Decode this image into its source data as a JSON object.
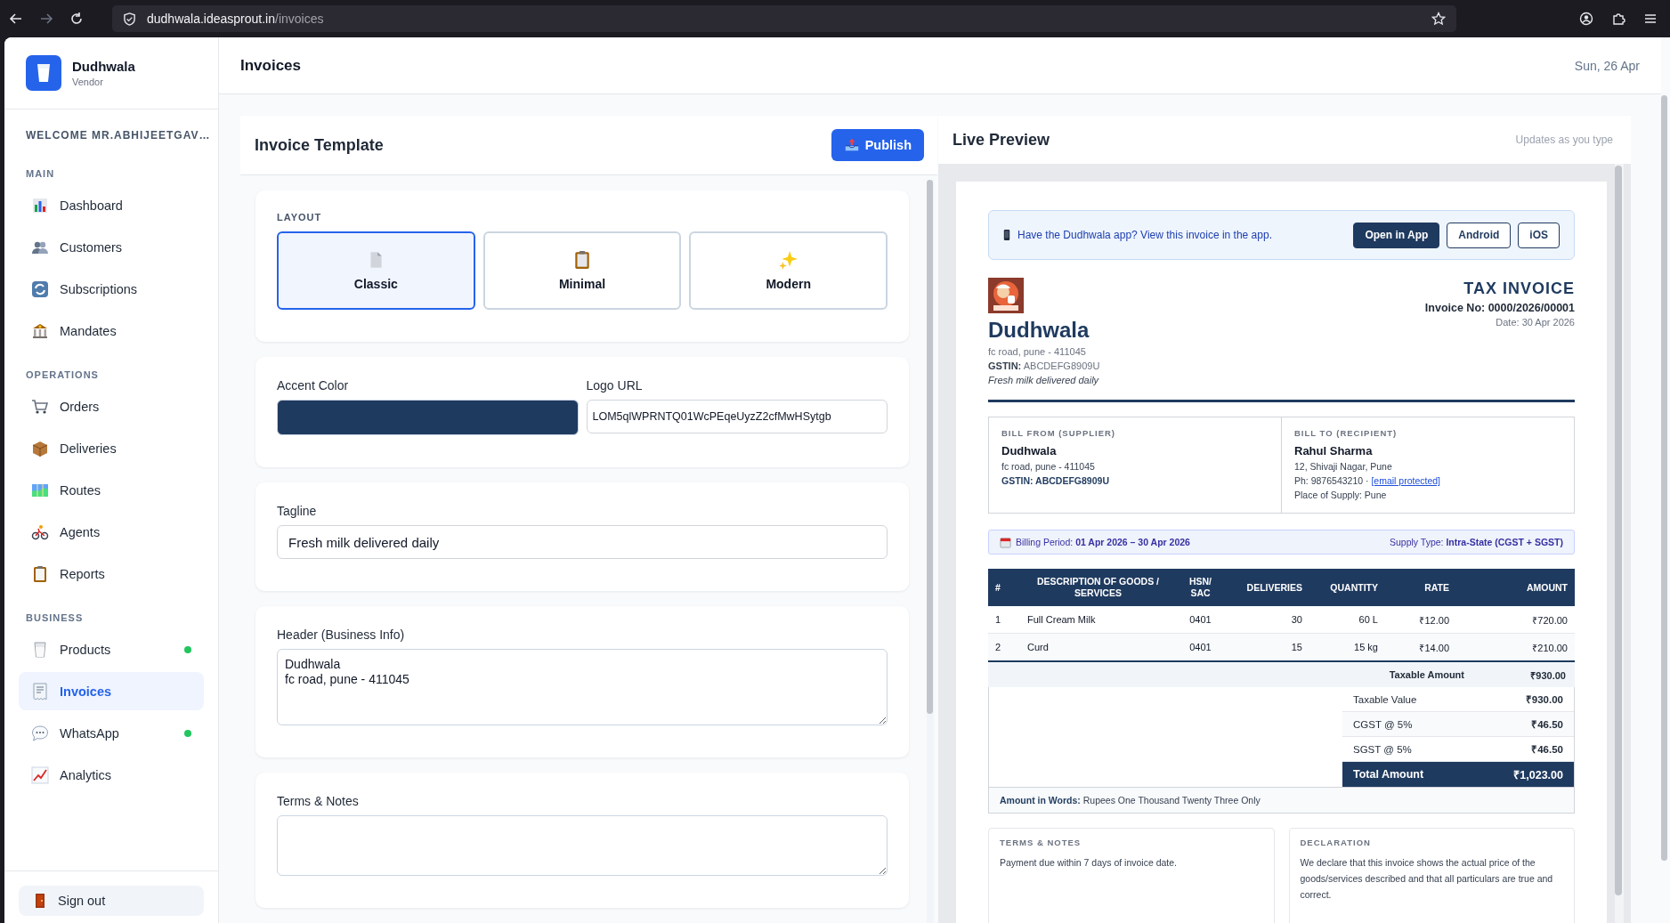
{
  "browser": {
    "url_host": "dudhwala.ideasprout.in",
    "url_path": "/invoices"
  },
  "sidebar": {
    "brand": "Dudhwala",
    "role": "Vendor",
    "welcome": "WELCOME MR.ABHIJEETGAV…",
    "sections": [
      {
        "title": "MAIN",
        "items": [
          {
            "label": "Dashboard",
            "selected": false,
            "status_dot": false
          },
          {
            "label": "Customers",
            "selected": false,
            "status_dot": false
          },
          {
            "label": "Subscriptions",
            "selected": false,
            "status_dot": false
          },
          {
            "label": "Mandates",
            "selected": false,
            "status_dot": false
          }
        ]
      },
      {
        "title": "OPERATIONS",
        "items": [
          {
            "label": "Orders",
            "selected": false,
            "status_dot": false
          },
          {
            "label": "Deliveries",
            "selected": false,
            "status_dot": false
          },
          {
            "label": "Routes",
            "selected": false,
            "status_dot": false
          },
          {
            "label": "Agents",
            "selected": false,
            "status_dot": false
          },
          {
            "label": "Reports",
            "selected": false,
            "status_dot": false
          }
        ]
      },
      {
        "title": "BUSINESS",
        "items": [
          {
            "label": "Products",
            "selected": false,
            "status_dot": true
          },
          {
            "label": "Invoices",
            "selected": true,
            "status_dot": false
          },
          {
            "label": "WhatsApp",
            "selected": false,
            "status_dot": true
          },
          {
            "label": "Analytics",
            "selected": false,
            "status_dot": false
          }
        ]
      }
    ],
    "sign_out": "Sign out"
  },
  "header": {
    "title": "Invoices",
    "date": "Sun, 26 Apr"
  },
  "editor": {
    "title": "Invoice Template",
    "publish": "Publish",
    "layout_label": "LAYOUT",
    "layouts": [
      {
        "label": "Classic",
        "selected": true
      },
      {
        "label": "Minimal",
        "selected": false
      },
      {
        "label": "Modern",
        "selected": false
      }
    ],
    "accent": {
      "label": "Accent Color",
      "color": "#1f3a5f"
    },
    "logo": {
      "label": "Logo URL",
      "value": "LOM5qlWPRNTQ01WcPEqeUyzZ2cfMwHSytgb"
    },
    "tagline": {
      "label": "Tagline",
      "value": "Fresh milk delivered daily"
    },
    "header_info": {
      "label": "Header (Business Info)",
      "value": "Dudhwala\nfc road, pune - 411045"
    },
    "terms": {
      "label": "Terms & Notes"
    }
  },
  "preview": {
    "title": "Live Preview",
    "hint": "Updates as you type",
    "banner": {
      "text": "Have the Dudhwala app? View this invoice in the app.",
      "buttons": [
        {
          "label": "Open in App",
          "kind": "primary"
        },
        {
          "label": "Android",
          "kind": "outline"
        },
        {
          "label": "iOS",
          "kind": "outline"
        }
      ]
    },
    "business": {
      "name": "Dudhwala",
      "address": "fc road, pune - 411045",
      "gstin": "**GSTIN:** ABCDEFG8909U",
      "tagline": "Fresh milk delivered daily"
    },
    "doc": {
      "title": "TAX INVOICE",
      "number": "Invoice No: 0000/2026/00001",
      "date": "Date: 30 Apr 2026"
    },
    "bill_from": {
      "heading": "BILL FROM (SUPPLIER)",
      "name": "Dudhwala",
      "address": "fc road, pune - 411045",
      "gstin": "GSTIN: ABCDEFG8909U"
    },
    "bill_to": {
      "heading": "BILL TO (RECIPIENT)",
      "name": "Rahul Sharma",
      "address": "12, Shivaji Nagar, Pune",
      "phone": "Ph: 9876543210 ·",
      "email": "[email protected]",
      "place": "Place of Supply: Pune"
    },
    "billing_period": "Billing Period: **01 Apr 2026 – 30 Apr 2026**",
    "supply_type": "Supply Type: **Intra-State (CGST + SGST)**",
    "table": {
      "columns": [
        "#",
        "DESCRIPTION OF GOODS / SERVICES",
        "HSN/ SAC",
        "DELIVERIES",
        "QUANTITY",
        "RATE",
        "AMOUNT"
      ],
      "rows": [
        [
          "1",
          "Full Cream Milk",
          "0401",
          "30",
          "60 L",
          "₹12.00",
          "₹720.00"
        ],
        [
          "2",
          "Curd",
          "0401",
          "15",
          "15 kg",
          "₹14.00",
          "₹210.00"
        ]
      ],
      "taxable_label": "Taxable Amount",
      "taxable_value": "₹930.00"
    },
    "summary": [
      {
        "label": "Taxable Value",
        "value": "₹930.00",
        "kind": "line"
      },
      {
        "label": "CGST @ 5%",
        "value": "₹46.50",
        "kind": "line"
      },
      {
        "label": "SGST @ 5%",
        "value": "₹46.50",
        "kind": "line"
      },
      {
        "label": "Total Amount",
        "value": "₹1,023.00",
        "kind": "total"
      }
    ],
    "amount_words": "**Amount in Words:** Rupees One Thousand Twenty Three Only",
    "terms": {
      "heading": "TERMS & NOTES",
      "text": "Payment due within 7 days of invoice date."
    },
    "declaration": {
      "heading": "DECLARATION",
      "text": "We declare that this invoice shows the actual price of the goods/services described and that all particulars are true and correct."
    }
  }
}
